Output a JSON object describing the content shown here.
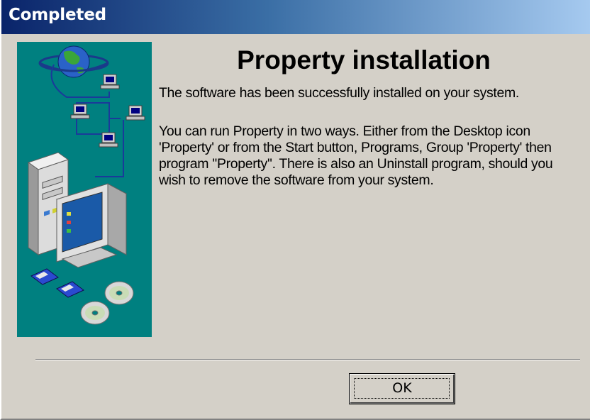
{
  "window": {
    "title": "Completed"
  },
  "content": {
    "heading": "Property installation",
    "line1": "The software has been successfully installed on your system.",
    "paragraph2": "You can run Property in two ways.  Either from the Desktop icon 'Property' or from the Start button, Programs, Group 'Property' then program ''Property''.  There is also an Uninstall program, should you wish to remove the software from your system."
  },
  "buttons": {
    "ok_label": "OK"
  },
  "colors": {
    "panel_background": "#d4d0c8",
    "illustration_background": "#008080",
    "titlebar_start": "#0a246a",
    "titlebar_end": "#a6caf0"
  }
}
